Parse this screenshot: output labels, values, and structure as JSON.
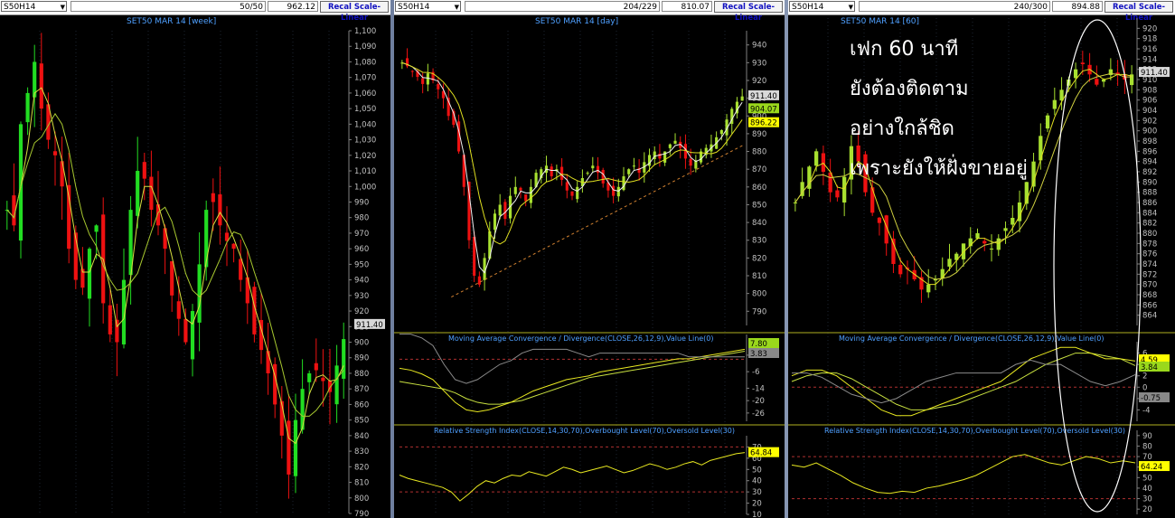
{
  "panels": [
    {
      "symbol": "S50H14",
      "counter": "50/50",
      "price": "962.12",
      "recal_label": "Recal Scale-Linear",
      "title": "SET50 MAR 14",
      "period": "[week]"
    },
    {
      "symbol": "S50H14",
      "counter": "204/229",
      "price": "810.07",
      "recal_label": "Recal Scale-Linear",
      "title": "SET50 MAR 14",
      "period": "[day]",
      "macd_title": "Moving Average Convergence / Divergence(CLOSE,26,12,9),Value Line(0)",
      "rsi_title": "Relative Strength Index(CLOSE,14,30,70),Overbought Level(70),Oversold Level(30)"
    },
    {
      "symbol": "S50H14",
      "counter": "240/300",
      "price": "894.88",
      "recal_label": "Recal Scale-Linear",
      "title": "SET50 MAR 14",
      "period": "[60]",
      "macd_title": "Moving Average Convergence / Divergence(CLOSE,26,12,9),Value Line(0)",
      "rsi_title": "Relative Strength Index(CLOSE,14,30,70),Overbought Level(70),Oversold Level(30)"
    }
  ],
  "annotation": {
    "lines": [
      "เฟก 60 นาที",
      "ยังต้องติดตาม",
      "อย่างใกล้ชิด",
      "เพราะยังให้ฝั่งขายอยู่"
    ]
  },
  "chart_data": [
    {
      "type": "candlestick",
      "title": "SET50 MAR 14 [week]",
      "ylim": [
        790,
        1100
      ],
      "yticks": [
        "1,100",
        "1,090",
        "1,080",
        "1,070",
        "1,060",
        "1,050",
        "1,040",
        "1,030",
        "1,020",
        "1,010",
        "1,000",
        "990",
        "980",
        "970",
        "960",
        "950",
        "940",
        "930",
        "920",
        "910",
        "900",
        "890",
        "880",
        "870",
        "860",
        "850",
        "840",
        "830",
        "820",
        "810",
        "800",
        "790"
      ],
      "ytick_values": [
        1100,
        1090,
        1080,
        1070,
        1060,
        1050,
        1040,
        1030,
        1020,
        1010,
        1000,
        990,
        980,
        970,
        960,
        950,
        940,
        930,
        920,
        910,
        900,
        890,
        880,
        870,
        860,
        850,
        840,
        830,
        820,
        810,
        800,
        790
      ],
      "last_label": "911.40",
      "last_value": 911.4,
      "close": [
        985,
        975,
        1040,
        1060,
        1080,
        1050,
        1030,
        1020,
        1000,
        960,
        940,
        935,
        960,
        975,
        925,
        905,
        900,
        940,
        985,
        1010,
        1005,
        985,
        975,
        960,
        930,
        915,
        900,
        920,
        950,
        985,
        990,
        975,
        965,
        960,
        940,
        925,
        905,
        895,
        880,
        860,
        840,
        815,
        850,
        870,
        880,
        882,
        875,
        868,
        885,
        902
      ],
      "series": [
        {
          "name": "ma_fast",
          "color": "#c8e01c"
        },
        {
          "name": "ma_slow",
          "color": "#d0d050"
        }
      ]
    },
    {
      "type": "candlestick",
      "title": "SET50 MAR 14 [day]",
      "ylim": [
        782,
        948
      ],
      "yticks": [
        "940",
        "930",
        "920",
        "910",
        "900",
        "890",
        "880",
        "870",
        "860",
        "850",
        "840",
        "830",
        "820",
        "810",
        "800",
        "790"
      ],
      "ytick_values": [
        940,
        930,
        920,
        910,
        900,
        890,
        880,
        870,
        860,
        850,
        840,
        830,
        820,
        810,
        800,
        790
      ],
      "price_labels": [
        {
          "text": "911.40",
          "value": 911.4,
          "bg": "#d8d8d8"
        },
        {
          "text": "904.07",
          "value": 904.07,
          "bg": "#9ad81c"
        },
        {
          "text": "896.22",
          "value": 896.22,
          "bg": "#ffff00"
        }
      ],
      "close": [
        930,
        928,
        925,
        922,
        918,
        924,
        920,
        915,
        910,
        900,
        895,
        880,
        860,
        830,
        810,
        805,
        820,
        835,
        845,
        850,
        842,
        855,
        860,
        858,
        852,
        860,
        868,
        870,
        872,
        866,
        870,
        864,
        858,
        855,
        860,
        865,
        868,
        872,
        868,
        862,
        858,
        855,
        860,
        866,
        870,
        872,
        868,
        874,
        878,
        880,
        876,
        880,
        884,
        886,
        882,
        876,
        872,
        875,
        880,
        882,
        884,
        888,
        892,
        898,
        904,
        908,
        911
      ],
      "trendline": {
        "from": [
          0.15,
          798
        ],
        "to": [
          1.0,
          884
        ],
        "color": "#d08030"
      },
      "macd": {
        "ylim": [
          -30,
          12
        ],
        "yticks": [
          "2",
          "-6",
          "-14",
          "-20",
          "-26"
        ],
        "ytick_values": [
          2,
          -6,
          -14,
          -20,
          -26
        ],
        "labels": [
          {
            "text": "7.80",
            "bg": "#9ad81c"
          },
          {
            "text": "3.83",
            "bg": "#888888"
          }
        ],
        "macd": [
          -2,
          -3,
          -5,
          -8,
          -14,
          -20,
          -24,
          -25,
          -24,
          -22,
          -20,
          -17,
          -14,
          -12,
          -10,
          -8,
          -7,
          -6,
          -4,
          -3,
          -2,
          -1,
          0,
          1,
          2,
          3,
          3,
          4,
          5,
          6,
          7,
          8
        ],
        "signal": [
          -9,
          -10,
          -11,
          -12,
          -13,
          -15,
          -18,
          -20,
          -21,
          -21,
          -20,
          -19,
          -17,
          -15,
          -13,
          -11,
          -9,
          -7,
          -6,
          -5,
          -4,
          -3,
          -2,
          -1,
          0,
          1,
          2,
          3,
          4,
          5,
          6,
          7
        ]
      },
      "rsi": {
        "ylim": [
          10,
          80
        ],
        "yticks": [
          "70",
          "60",
          "50",
          "40",
          "30",
          "20",
          "10"
        ],
        "ytick_values": [
          70,
          60,
          50,
          40,
          30,
          20,
          10
        ],
        "last_label": "64.84",
        "values": [
          45,
          42,
          40,
          38,
          36,
          34,
          30,
          22,
          28,
          35,
          40,
          38,
          42,
          45,
          44,
          48,
          46,
          44,
          48,
          52,
          50,
          47,
          49,
          51,
          53,
          50,
          47,
          49,
          52,
          55,
          53,
          50,
          52,
          55,
          57,
          54,
          58,
          60,
          62,
          64,
          65
        ]
      }
    },
    {
      "type": "candlestick",
      "title": "SET50 MAR 14 [60]",
      "ylim": [
        862,
        922
      ],
      "yticks": [
        "920",
        "918",
        "916",
        "914",
        "912",
        "910",
        "908",
        "906",
        "904",
        "902",
        "900",
        "898",
        "896",
        "894",
        "892",
        "890",
        "888",
        "886",
        "884",
        "882",
        "880",
        "878",
        "876",
        "874",
        "872",
        "870",
        "868",
        "866",
        "864"
      ],
      "ytick_values": [
        920,
        918,
        916,
        914,
        912,
        910,
        908,
        906,
        904,
        902,
        900,
        898,
        896,
        894,
        892,
        890,
        888,
        886,
        884,
        882,
        880,
        878,
        876,
        874,
        872,
        870,
        868,
        866,
        864
      ],
      "last_label": "911.40",
      "last_value": 911.4,
      "close": [
        886,
        890,
        893,
        896,
        892,
        888,
        887,
        891,
        897,
        894,
        888,
        884,
        882,
        878,
        874,
        872,
        873,
        871,
        869,
        870,
        871,
        873,
        875,
        876,
        878,
        879,
        880,
        878,
        877,
        879,
        881,
        883,
        886,
        890,
        894,
        899,
        903,
        906,
        908,
        910,
        912,
        913,
        911,
        909,
        910,
        912,
        911,
        910,
        911
      ],
      "macd": {
        "ylim": [
          -6,
          8
        ],
        "yticks": [
          "6",
          "4",
          "2",
          "0",
          "-2",
          "-4"
        ],
        "ytick_values": [
          6,
          4,
          2,
          0,
          -2,
          -4
        ],
        "labels": [
          {
            "text": "4.59",
            "bg": "#ffff00"
          },
          {
            "text": "3.84",
            "bg": "#9ad81c"
          },
          {
            "text": "-0.75",
            "bg": "#888888"
          }
        ],
        "macd": [
          2,
          3,
          3,
          2,
          0,
          -2,
          -4,
          -5,
          -5,
          -4,
          -3,
          -2,
          -1,
          0,
          1,
          3,
          5,
          6,
          7,
          7,
          6,
          5,
          5,
          4.6
        ],
        "signal": [
          1,
          2,
          2.5,
          2.5,
          1.5,
          0,
          -1.5,
          -3,
          -4,
          -4,
          -3.5,
          -3,
          -2,
          -1,
          0,
          1,
          2.5,
          4,
          5,
          6,
          6,
          5.5,
          5,
          3.8
        ]
      },
      "rsi": {
        "ylim": [
          15,
          95
        ],
        "yticks": [
          "90",
          "80",
          "70",
          "60",
          "50",
          "40",
          "30",
          "20"
        ],
        "ytick_values": [
          90,
          80,
          70,
          60,
          50,
          40,
          30,
          20
        ],
        "last_label": "64.24",
        "values": [
          62,
          60,
          64,
          58,
          52,
          45,
          40,
          36,
          35,
          37,
          36,
          40,
          42,
          45,
          48,
          52,
          58,
          64,
          70,
          72,
          68,
          64,
          62,
          66,
          70,
          68,
          64,
          66,
          64
        ]
      }
    }
  ]
}
